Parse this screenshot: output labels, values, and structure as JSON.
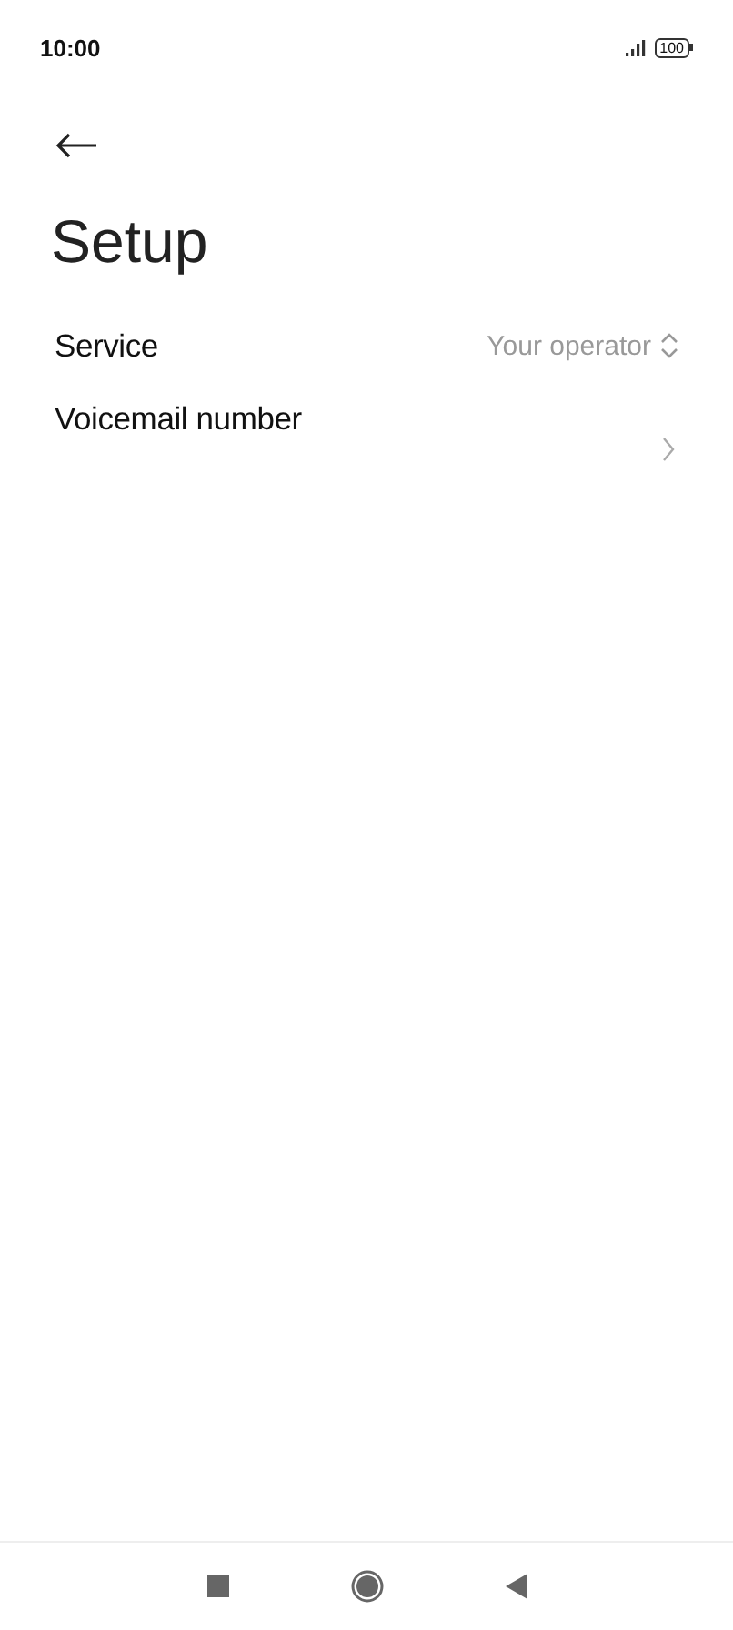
{
  "status_bar": {
    "time": "10:00",
    "battery": "100"
  },
  "title": "Setup",
  "rows": [
    {
      "kind": "select",
      "label": "Service",
      "value": "Your operator"
    },
    {
      "kind": "link",
      "label": "Voicemail number"
    }
  ]
}
